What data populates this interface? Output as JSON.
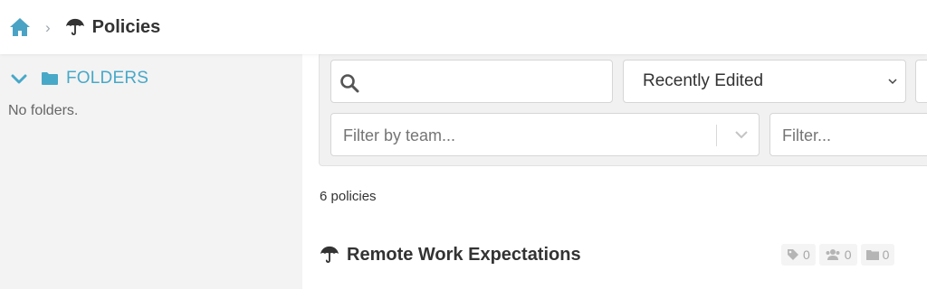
{
  "breadcrumb": {
    "home_icon": "home-icon",
    "separator": "›",
    "page_icon": "umbrella-icon",
    "title": "Policies"
  },
  "sidebar": {
    "folders_label": "FOLDERS",
    "empty_text": "No folders."
  },
  "filters": {
    "search": {
      "value": "",
      "placeholder": ""
    },
    "sort": {
      "selected": "Recently Edited"
    },
    "team": {
      "placeholder": "Filter by team..."
    },
    "text_filter": {
      "placeholder": "Filter..."
    }
  },
  "results": {
    "count_label": "6 policies"
  },
  "policies": [
    {
      "title": "Remote Work Expectations",
      "tags": "0",
      "teams": "0",
      "folders": "0"
    }
  ],
  "colors": {
    "accent": "#48a8c8",
    "home": "#4aa3c5"
  }
}
